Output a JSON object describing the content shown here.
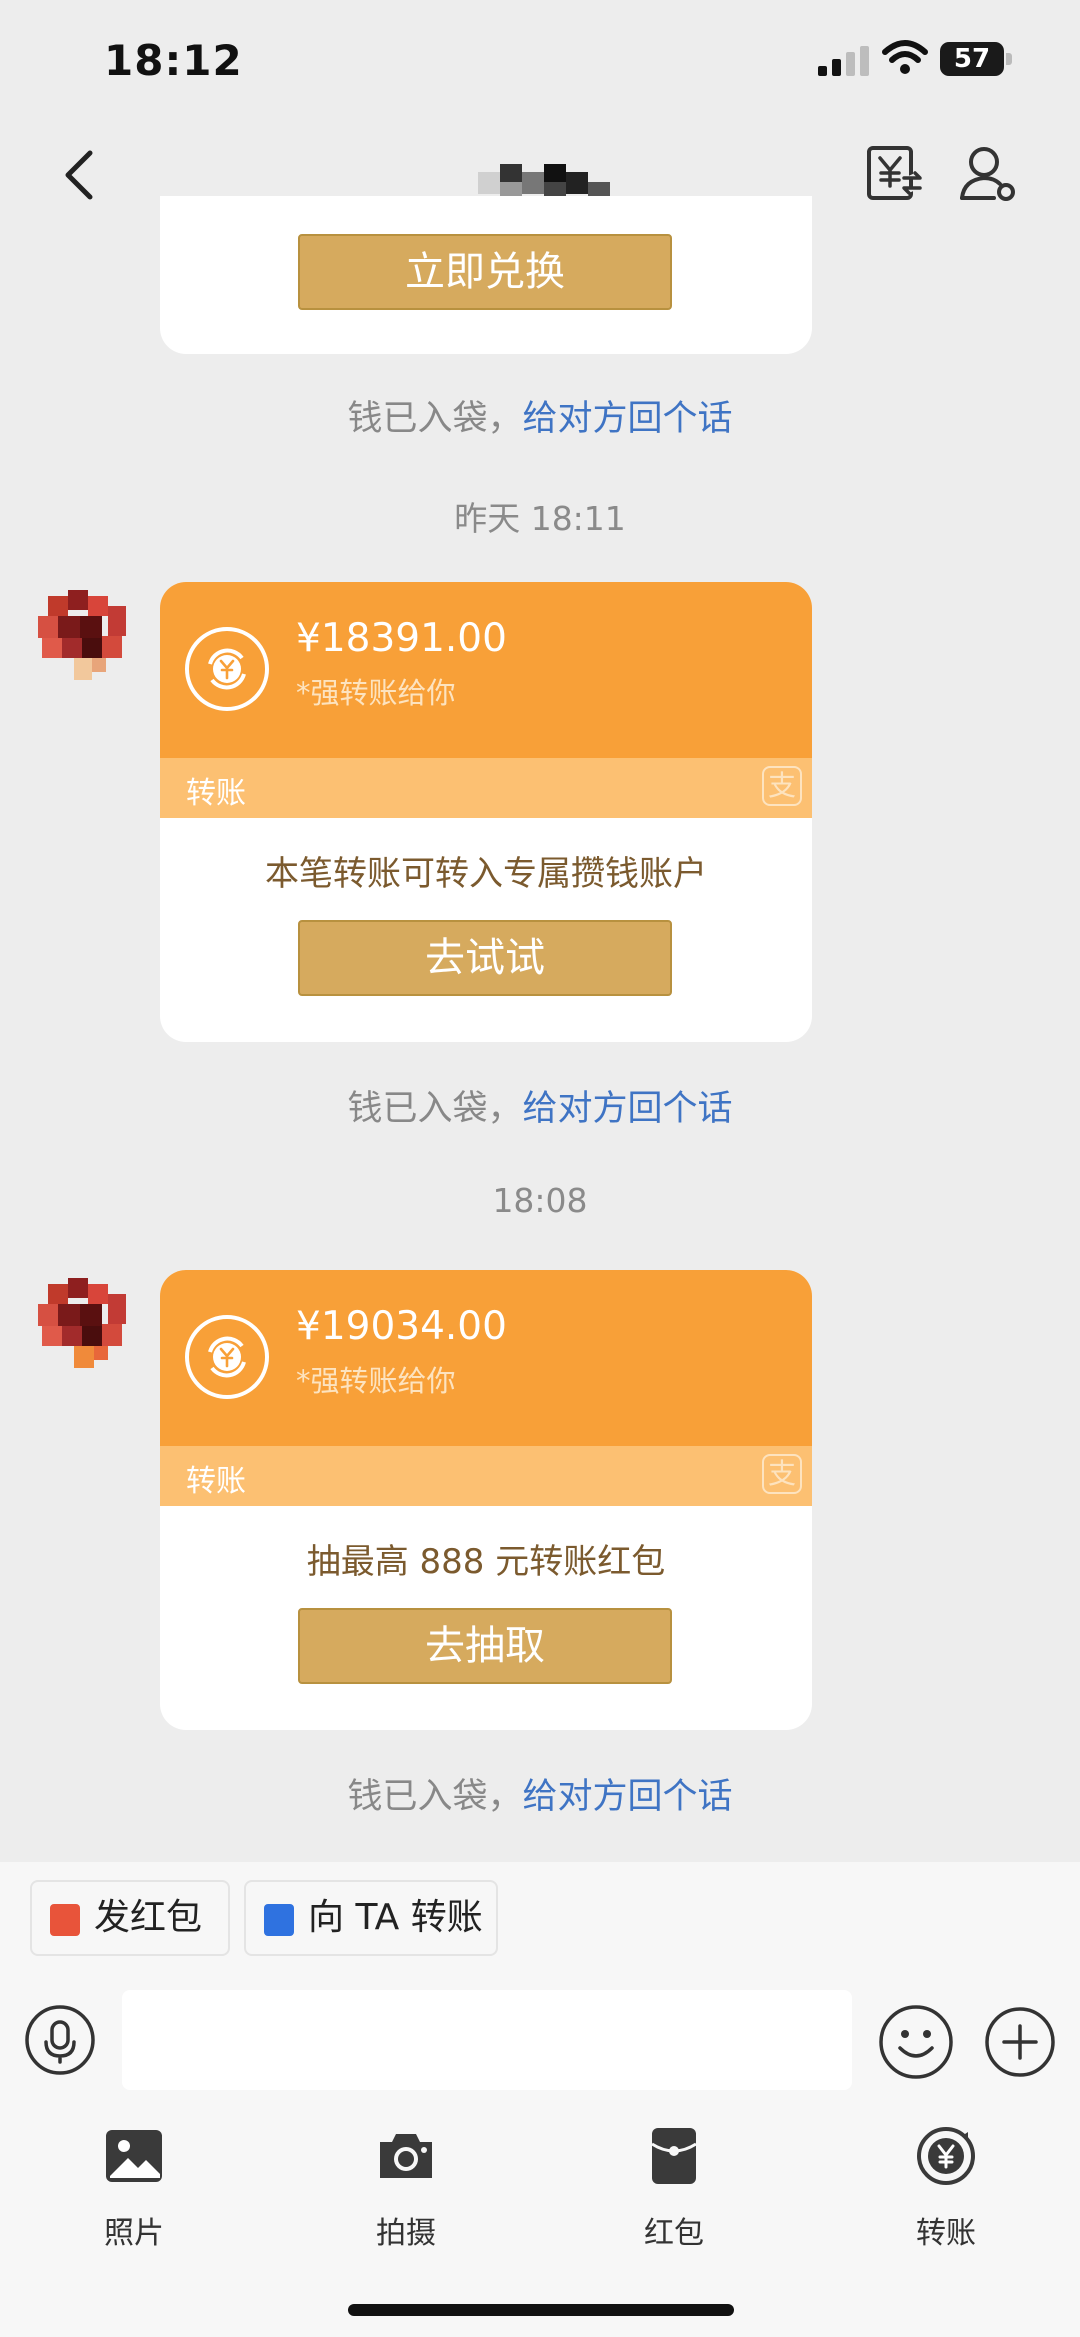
{
  "status": {
    "time": "18:12",
    "battery": "57"
  },
  "nav": {
    "title_obscured": true
  },
  "top_card": {
    "button": "立即兑换"
  },
  "notes": {
    "received": "钱已入袋，",
    "reply": "给对方回个话"
  },
  "messages": [
    {
      "time": "昨天 18:11",
      "amount": "¥18391.00",
      "subtitle": "*强转账给你",
      "band": "转账",
      "band_logo": "支",
      "promo": "本笔转账可转入专属攒钱账户",
      "button": "去试试"
    },
    {
      "time": "18:08",
      "amount": "¥19034.00",
      "subtitle": "*强转账给你",
      "band": "转账",
      "band_logo": "支",
      "promo": "抽最高 888 元转账红包",
      "button": "去抽取"
    }
  ],
  "quick_actions": [
    {
      "label": "发红包",
      "icon": "red-packet-icon"
    },
    {
      "label": "向 TA 转账",
      "icon": "transfer-icon"
    }
  ],
  "tray": [
    {
      "label": "照片",
      "icon": "photo-icon"
    },
    {
      "label": "拍摄",
      "icon": "camera-icon"
    },
    {
      "label": "红包",
      "icon": "red-packet-icon"
    },
    {
      "label": "转账",
      "icon": "transfer-icon"
    }
  ],
  "colors": {
    "orange": "#f8a038",
    "band": "#fcc072",
    "gold_button": "#d6aa5e",
    "link": "#3f74c4"
  }
}
